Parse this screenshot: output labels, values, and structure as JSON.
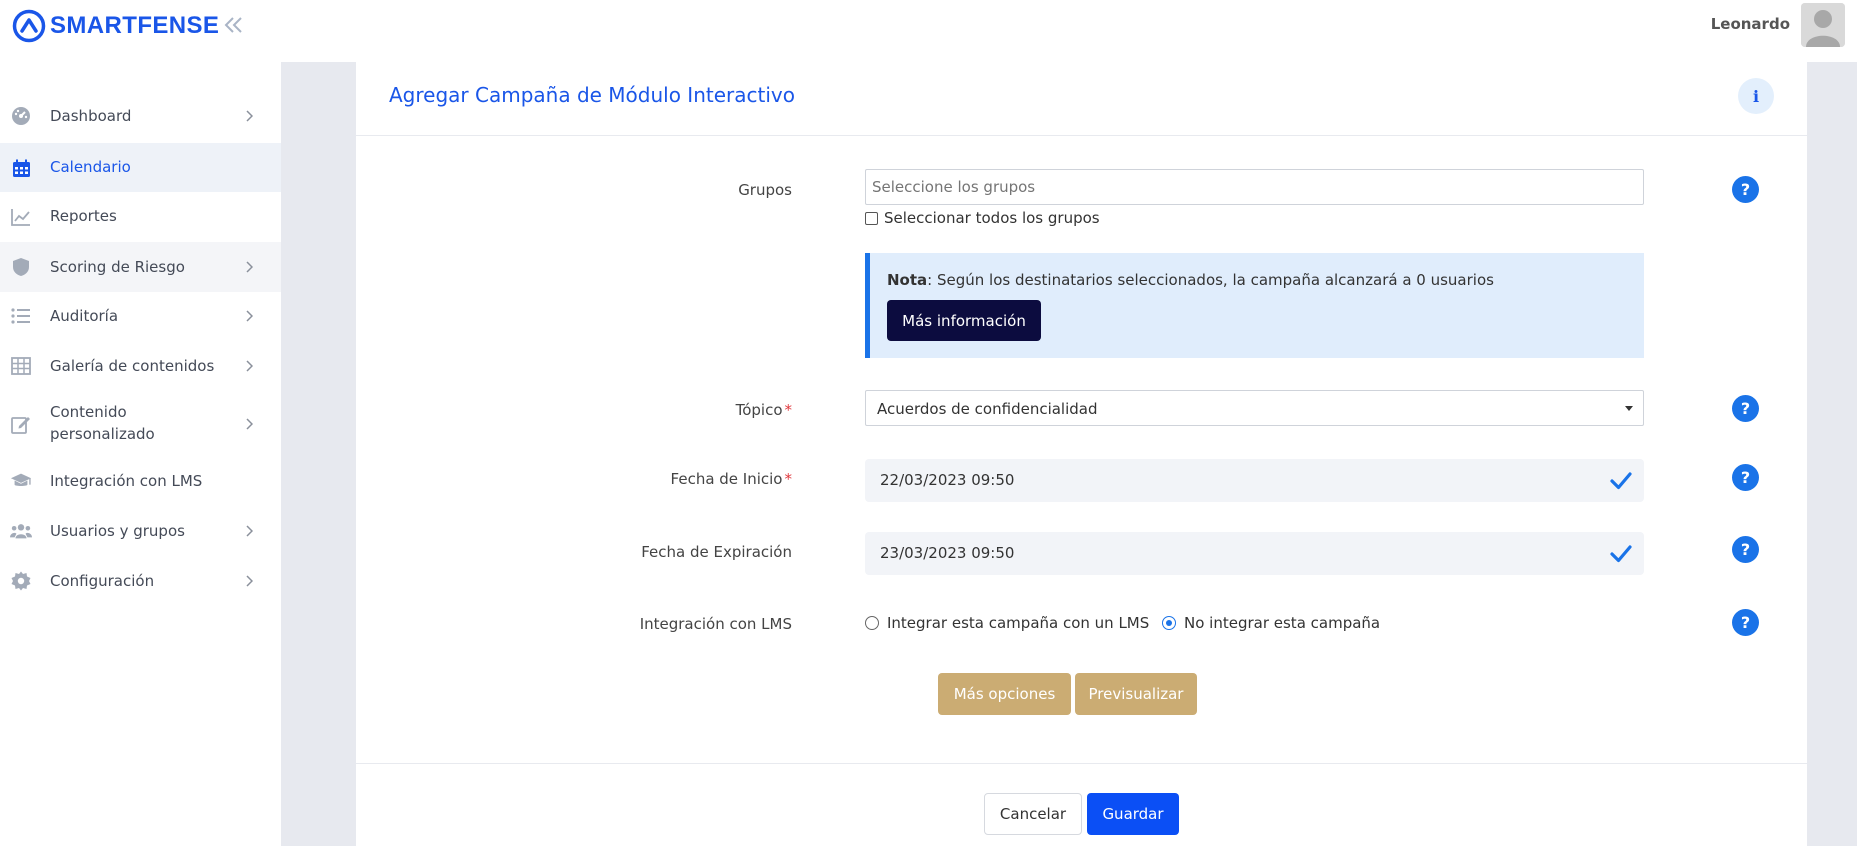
{
  "brand": {
    "name": "SMARTFENSE",
    "color": "#1a56e8"
  },
  "sidebar": {
    "collapse_icon": "double-chevron-left-icon",
    "items": [
      {
        "label": "Dashboard",
        "icon": "speedometer-icon",
        "has_chevron": true,
        "active": false
      },
      {
        "label": "Calendario",
        "icon": "calendar-icon",
        "has_chevron": false,
        "active": true
      },
      {
        "label": "Reportes",
        "icon": "line-chart-icon",
        "has_chevron": false,
        "active": false
      },
      {
        "label": "Scoring de Riesgo",
        "icon": "shield-icon",
        "has_chevron": true,
        "active": false
      },
      {
        "label": "Auditoría",
        "icon": "list-icon",
        "has_chevron": true,
        "active": false
      },
      {
        "label": "Galería de contenidos",
        "icon": "grid-icon",
        "has_chevron": true,
        "active": false
      },
      {
        "label_line1": "Contenido",
        "label_line2": "personalizado",
        "icon": "edit-icon",
        "has_chevron": true,
        "active": false
      },
      {
        "label": "Integración con LMS",
        "icon": "graduation-cap-icon",
        "has_chevron": false,
        "active": false
      },
      {
        "label": "Usuarios y grupos",
        "icon": "users-icon",
        "has_chevron": true,
        "active": false
      },
      {
        "label": "Configuración",
        "icon": "gear-icon",
        "has_chevron": true,
        "active": false
      }
    ]
  },
  "topbar": {
    "username": "Leonardo",
    "avatar_icon": "user-avatar-icon"
  },
  "card": {
    "title": "Agregar Campaña de Módulo Interactivo",
    "info_label": "i"
  },
  "form": {
    "groups": {
      "label": "Grupos",
      "placeholder": "Seleccione los grupos",
      "select_all_label": "Seleccionar todos los grupos",
      "select_all_checked": false
    },
    "note": {
      "bold": "Nota",
      "text": ": Según los destinatarios seleccionados, la campaña alcanzará a 0 usuarios",
      "button": "Más información"
    },
    "topic": {
      "label": "Tópico",
      "required_mark": "*",
      "value": "Acuerdos de confidencialidad"
    },
    "start_date": {
      "label": "Fecha de Inicio",
      "required_mark": "*",
      "value": "22/03/2023 09:50"
    },
    "expiration_date": {
      "label": "Fecha de Expiración",
      "value": "23/03/2023 09:50"
    },
    "lms": {
      "label": "Integración con LMS",
      "option_integrate": "Integrar esta campaña con un LMS",
      "option_no_integrate": "No integrar esta campaña",
      "selected": "No integrar esta campaña"
    },
    "help_label": "?",
    "more_options_button": "Más opciones",
    "preview_button": "Previsualizar"
  },
  "footer": {
    "cancel_button": "Cancelar",
    "save_button": "Guardar"
  },
  "colors": {
    "primary": "#1a56e8",
    "save": "#0b4ff5",
    "tan": "#cbac73",
    "note_bg": "#e0edfc",
    "note_button": "#0c0c3f"
  }
}
